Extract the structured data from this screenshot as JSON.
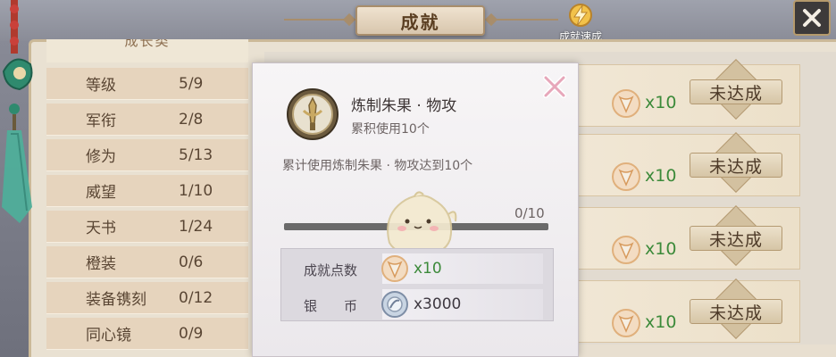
{
  "header": {
    "title": "成就",
    "quick_label": "成就速成"
  },
  "stats": {
    "header": "成长类",
    "rows": [
      {
        "name": "等级",
        "value": "5/9"
      },
      {
        "name": "军衔",
        "value": "2/8"
      },
      {
        "name": "修为",
        "value": "5/13"
      },
      {
        "name": "威望",
        "value": "1/10"
      },
      {
        "name": "天书",
        "value": "1/24"
      },
      {
        "name": "橙装",
        "value": "0/6"
      },
      {
        "name": "装备镌刻",
        "value": "0/12"
      },
      {
        "name": "同心镜",
        "value": "0/9"
      }
    ]
  },
  "achievements": [
    {
      "count": "x10",
      "status": "未达成"
    },
    {
      "count": "x10",
      "status": "未达成"
    },
    {
      "count": "x10",
      "status": "未达成"
    },
    {
      "count": "x10",
      "status": "未达成"
    }
  ],
  "popup": {
    "title": "炼制朱果 · 物攻",
    "subtitle": "累积使用10个",
    "description": "累计使用炼制朱果 · 物攻达到10个",
    "progress_text": "0/10",
    "progress_fraction": 0,
    "rewards": [
      {
        "label": "成就点数",
        "amount": "x10",
        "icon": "achievement-point-icon"
      },
      {
        "label": "银　　币",
        "amount": "x3000",
        "icon": "silver-coin-icon"
      }
    ]
  },
  "colors": {
    "green_count": "#3c8a3a",
    "brown_text": "#5a4634",
    "progress_fill": "#d8b76a"
  }
}
